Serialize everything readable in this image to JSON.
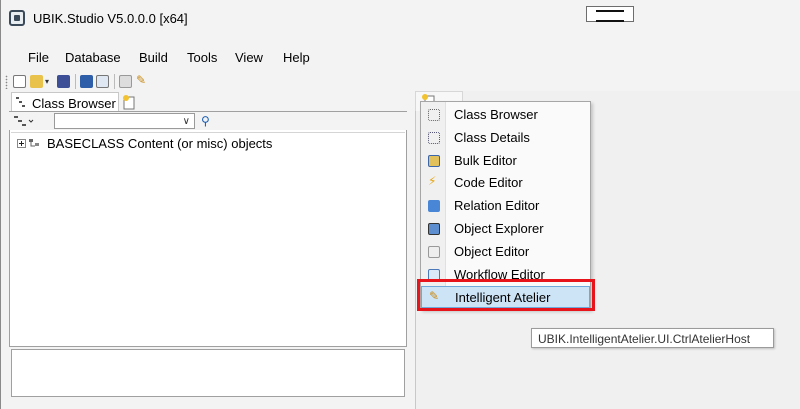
{
  "window": {
    "title": "UBIK.Studio V5.0.0.0 [x64]"
  },
  "menubar": {
    "items": [
      "File",
      "Database",
      "Build",
      "Tools",
      "View",
      "Help"
    ]
  },
  "toolbar": {
    "icons": [
      "new-icon",
      "open-icon",
      "dropdown-arrow-icon",
      "db-icon",
      "save-icon",
      "layout-icon",
      "copy-icon",
      "wand-icon"
    ]
  },
  "left": {
    "tab_label": "Class Browser",
    "tree": {
      "items": [
        {
          "label": "BASECLASS Content (or misc) objects"
        }
      ]
    }
  },
  "dropdown": {
    "items": [
      {
        "label": "Class Browser",
        "icon": "class-browser-icon"
      },
      {
        "label": "Class Details",
        "icon": "class-details-icon"
      },
      {
        "label": "Bulk Editor",
        "icon": "bulk-editor-icon"
      },
      {
        "label": "Code Editor",
        "icon": "code-editor-icon"
      },
      {
        "label": "Relation Editor",
        "icon": "relation-editor-icon"
      },
      {
        "label": "Object Explorer",
        "icon": "object-explorer-icon"
      },
      {
        "label": "Object Editor",
        "icon": "object-editor-icon"
      },
      {
        "label": "Workflow Editor",
        "icon": "workflow-editor-icon"
      },
      {
        "label": "Intelligent Atelier",
        "icon": "wand-icon",
        "selected": true
      }
    ]
  },
  "tooltip": {
    "text": "UBIK.IntelligentAtelier.UI.CtrlAtelierHost"
  },
  "colors": {
    "highlight": "#e8141c",
    "selection": "#cde4f7",
    "selection_border": "#6fa9dc"
  }
}
